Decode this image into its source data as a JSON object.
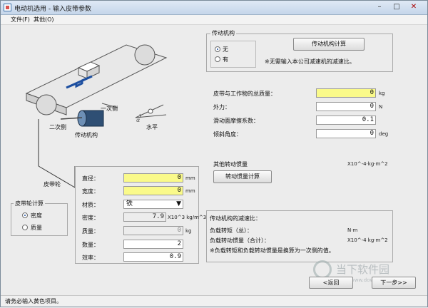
{
  "window": {
    "title": "电动机选用 - 输入皮带参数"
  },
  "menu": {
    "file": "文件(F)",
    "other": "其他(O)"
  },
  "diagram": {
    "label_secondary_side": "一次侧",
    "label_primary_side": "二次侧",
    "label_mechanism": "传动机构",
    "label_horizontal": "水平",
    "label_alpha": "α"
  },
  "transmission": {
    "group_title": "传动机构",
    "option_none": "无",
    "option_yes": "有",
    "calc_button": "传动机构计算",
    "note": "※无需输入本公司减速机的减速比。"
  },
  "params": {
    "rows": [
      {
        "label": "皮带与工作物的总质量：",
        "value": "0",
        "unit": "kg"
      },
      {
        "label": "外力：",
        "value": "0",
        "unit": "N"
      },
      {
        "label": "滑动面摩擦系数：",
        "value": "0.1",
        "unit": ""
      },
      {
        "label": "倾斜角度：",
        "value": "0",
        "unit": "deg"
      }
    ]
  },
  "inertia": {
    "label": "其他转动惯量",
    "unit": "X10^-4·kg·m^2",
    "calc_button": "转动惯量计算"
  },
  "pulley": {
    "label": "皮带轮",
    "rows": [
      {
        "label": "直径：",
        "value": "0",
        "unit": "mm"
      },
      {
        "label": "宽度：",
        "value": "0",
        "unit": "mm"
      }
    ],
    "material_label": "材质：",
    "material_value": "铁",
    "density_label": "密度：",
    "density_value": "7.9",
    "density_unit": "X10^3 kg/m^3",
    "mass_label": "质量：",
    "mass_value": "0",
    "mass_unit": "kg",
    "qty_label": "数量：",
    "qty_value": "2",
    "eff_label": "效率：",
    "eff_value": "0.9"
  },
  "calc_mode": {
    "group_title": "皮带轮计算",
    "option_density": "密度",
    "option_mass": "质量"
  },
  "results": {
    "ratio_label": "传动机构的减速比：",
    "torque_label": "负载转矩（总）：",
    "torque_unit": "N·m",
    "inertia_label": "负载转动惯量（合计）：",
    "inertia_unit": "X10^-4 kg·m^2",
    "note": "※负载转矩和负载转动惯量是换算为一次侧的值。"
  },
  "nav": {
    "back": "<返回",
    "next": "下一步>>"
  },
  "status": {
    "text": "请务必输入黄色项目。"
  },
  "watermark": {
    "text": "当下软件园",
    "sub": "www.downxia.com"
  },
  "colors": {
    "required": "#fafa8a",
    "accent": "#1d4fa0"
  }
}
